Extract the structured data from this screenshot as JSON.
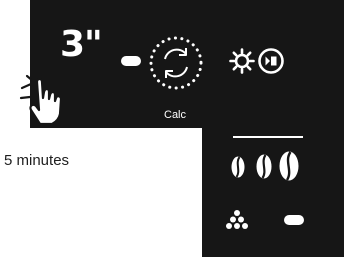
{
  "display": {
    "timer_text": "3\"",
    "calc_label": "Calc",
    "status_icons": [
      "minus-pill-icon",
      "cycle-icon",
      "sun-icon",
      "play-stop-icon"
    ],
    "bean_icons": [
      "coffee-bean-icon",
      "coffee-bean-icon",
      "coffee-bean-icon"
    ],
    "bottom_icons": [
      "grounds-icon",
      "minus-pill-icon"
    ]
  },
  "description": {
    "text": "5 minutes"
  },
  "colors": {
    "panel": "#161616",
    "foreground": "#ffffff",
    "text": "#1e1e1e"
  }
}
